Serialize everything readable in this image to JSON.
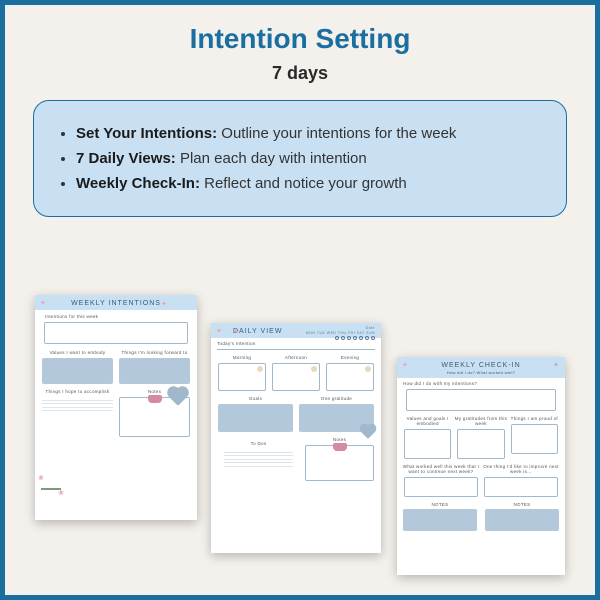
{
  "title": "Intention Setting",
  "subtitle": "7 days",
  "bullets": [
    {
      "bold": "Set Your Intentions:",
      "text": " Outline your intentions for the week"
    },
    {
      "bold": "7 Daily Views:",
      "text": " Plan each day with intention"
    },
    {
      "bold": "Weekly Check-In:",
      "text": " Reflect and notice your growth"
    }
  ],
  "page1": {
    "heading": "WEEKLY INTENTIONS",
    "s1": "Intentions for this week",
    "s2a": "Values I want to embody",
    "s2b": "Things I'm looking forward to",
    "s3a": "Things I hope to accomplish",
    "s3b": "Notes"
  },
  "page2": {
    "heading": "DAILY VIEW",
    "date": "Date",
    "days": "MON TUE WED THU FRI SAT SUN",
    "intention": "Today's Intention",
    "c1": "Morning",
    "c2": "Afternoon",
    "c3": "Evening",
    "g": "Goals",
    "grat": "One gratitude",
    "todo": "To Dos",
    "notes": "Notes"
  },
  "page3": {
    "heading": "WEEKLY CHECK-IN",
    "sub": "How did I do? What worked well?",
    "q1": "How did I do with my intentions?",
    "t1": "Values and goals I embodied",
    "t2": "My gratitudes from this week",
    "t3": "Things I am proud of",
    "b1": "What worked well this week that I want to continue next week?",
    "b2": "One thing I'd like to improve next week is…",
    "n": "NOTES"
  }
}
